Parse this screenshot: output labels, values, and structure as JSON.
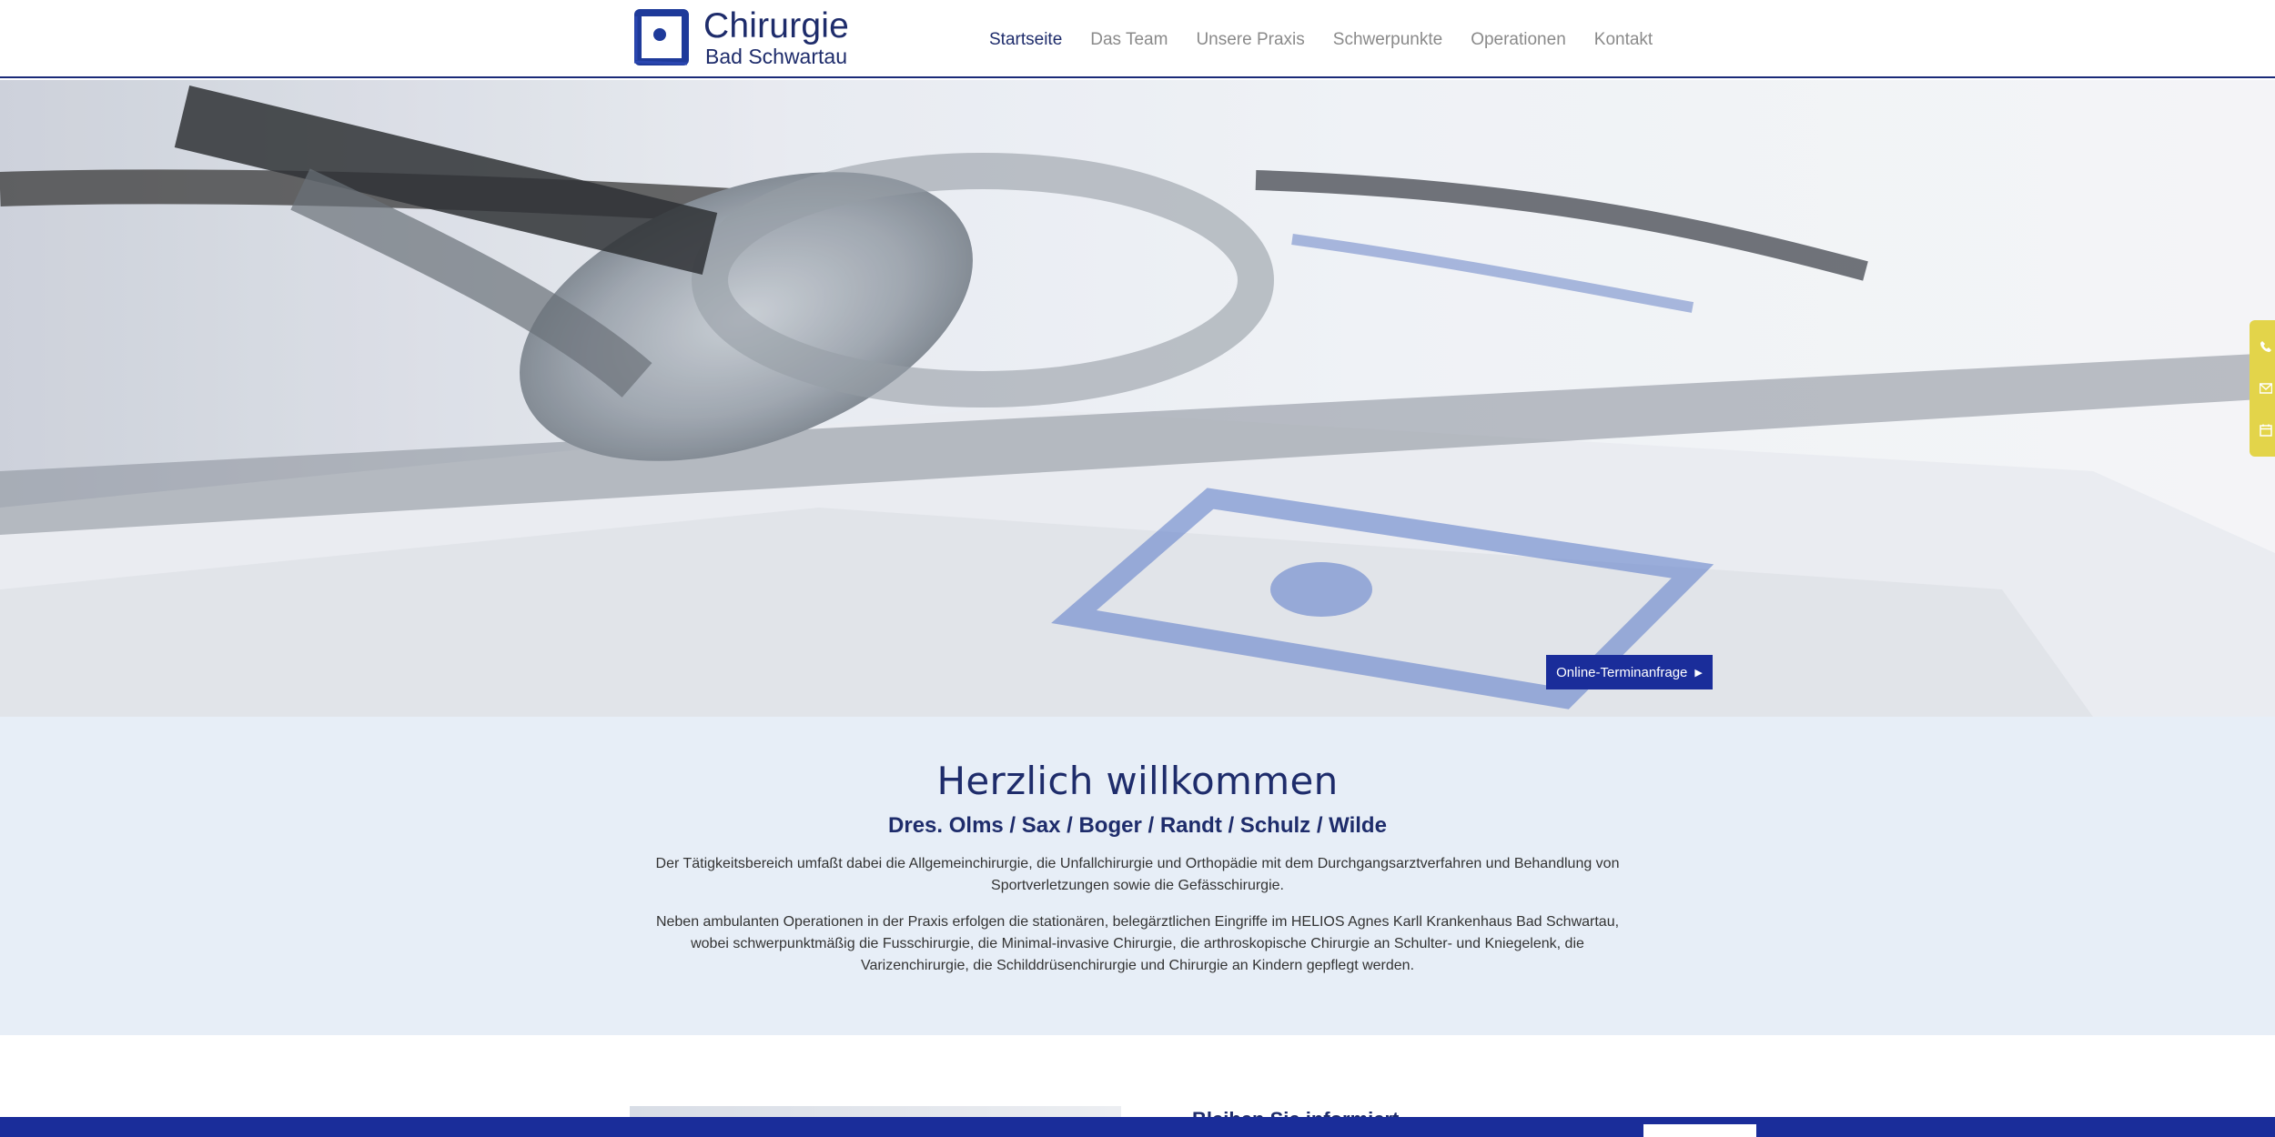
{
  "brand": {
    "title": "Chirurgie",
    "subtitle": "Bad Schwartau",
    "color": "#1e2c6b"
  },
  "nav": {
    "items": [
      {
        "label": "Startseite",
        "active": true
      },
      {
        "label": "Das Team",
        "active": false
      },
      {
        "label": "Unsere Praxis",
        "active": false
      },
      {
        "label": "Schwerpunkte",
        "active": false
      },
      {
        "label": "Operationen",
        "active": false
      },
      {
        "label": "Kontakt",
        "active": false
      }
    ]
  },
  "hero": {
    "cta_label": "Online-Terminanfrage",
    "cta_color": "#1a2d9a"
  },
  "side_tab": {
    "color": "#e3d44a",
    "icons": [
      "phone-icon",
      "mail-icon",
      "calendar-icon"
    ]
  },
  "welcome": {
    "title": "Herzlich willkommen",
    "subtitle": "Dres. Olms / Sax / Boger / Randt / Schulz / Wilde",
    "paragraph1": "Der Tätigkeitsbereich umfaßt dabei die Allgemeinchirurgie, die Unfallchirurgie und Orthopädie mit dem Durchgangsarztverfahren und Behandlung von Sportverletzungen sowie die Gefässchirurgie.",
    "paragraph2": "Neben ambulanten Operationen in der Praxis erfolgen die stationären, belegärztlichen Eingriffe im HELIOS Agnes Karll Krankenhaus Bad Schwartau, wobei schwerpunktmäßig die Fusschirurgie, die Minimal-invasive Chirurgie, die arthroskopische Chirurgie an Schulter- und Kniegelenk, die Varizenchirurgie, die Schilddrüsenchirurgie und Chirurgie an Kindern gepflegt werden.",
    "background": "#e7eef7"
  },
  "lower": {
    "heading": "Bleiben Sie informiert"
  }
}
